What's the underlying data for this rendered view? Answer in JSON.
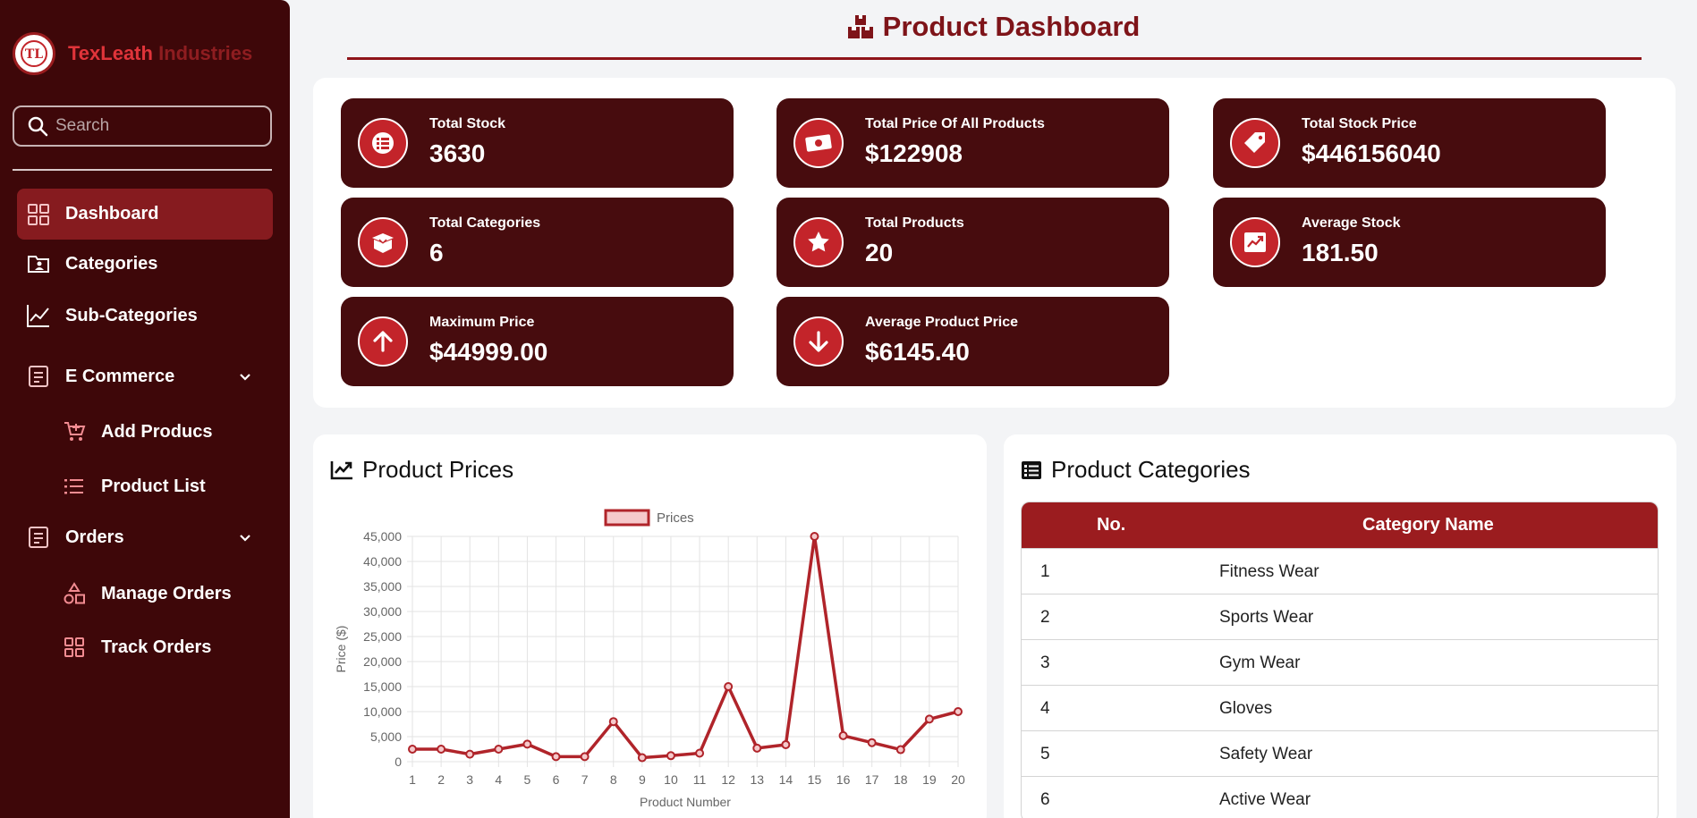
{
  "brand": {
    "name_part1": "TexLeath",
    "name_part2": "Industries",
    "logo_text": "TL"
  },
  "search": {
    "placeholder": "Search"
  },
  "sidebar": {
    "items": [
      {
        "label": "Dashboard",
        "icon": "grid-icon",
        "active": true
      },
      {
        "label": "Categories",
        "icon": "folder-user-icon"
      },
      {
        "label": "Sub-Categories",
        "icon": "line-chart-icon"
      },
      {
        "label": "E Commerce",
        "icon": "document-list-icon",
        "expandable": true
      },
      {
        "label": "Add Producs",
        "icon": "cart-add-icon",
        "sub": true
      },
      {
        "label": "Product List",
        "icon": "list-icon",
        "sub": true
      },
      {
        "label": "Orders",
        "icon": "document-list-icon",
        "expandable": true
      },
      {
        "label": "Manage Orders",
        "icon": "shapes-icon",
        "sub": true
      },
      {
        "label": "Track Orders",
        "icon": "grid-icon",
        "sub": true
      }
    ]
  },
  "header": {
    "title": "Product Dashboard",
    "icon": "boxes-icon"
  },
  "stats": [
    {
      "label": "Total Stock",
      "value": "3630",
      "icon": "list-icon"
    },
    {
      "label": "Total Price Of All Products",
      "value": "$122908",
      "icon": "money-icon"
    },
    {
      "label": "Total Stock Price",
      "value": "$446156040",
      "icon": "tag-icon"
    },
    {
      "label": "Total Categories",
      "value": "6",
      "icon": "open-box-icon"
    },
    {
      "label": "Total Products",
      "value": "20",
      "icon": "star-icon"
    },
    {
      "label": "Average Stock",
      "value": "181.50",
      "icon": "trend-up-icon"
    },
    {
      "label": "Maximum Price",
      "value": "$44999.00",
      "icon": "arrow-up-icon"
    },
    {
      "label": "Average Product Price",
      "value": "$6145.40",
      "icon": "arrow-down-icon"
    }
  ],
  "chart_panel": {
    "title": "Product Prices",
    "icon": "chart-line-icon"
  },
  "chart_data": {
    "type": "line",
    "title": "",
    "xlabel": "Product Number",
    "ylabel": "Price ($)",
    "x": [
      1,
      2,
      3,
      4,
      5,
      6,
      7,
      8,
      9,
      10,
      11,
      12,
      13,
      14,
      15,
      16,
      17,
      18,
      19,
      20
    ],
    "series": [
      {
        "name": "Prices",
        "values": [
          2500,
          2500,
          1500,
          2500,
          3500,
          1000,
          1000,
          8000,
          800,
          1200,
          1700,
          15000,
          2700,
          3400,
          44999,
          5200,
          3800,
          2400,
          8500,
          10000
        ]
      }
    ],
    "yticks": [
      "0",
      "5,000",
      "10,000",
      "15,000",
      "20,000",
      "25,000",
      "30,000",
      "35,000",
      "40,000",
      "45,000"
    ],
    "ylim": [
      0,
      45000
    ],
    "grid": true,
    "legend": "top-center",
    "line_color": "#b0242a"
  },
  "categories_panel": {
    "title": "Product Categories",
    "icon": "list-alt-icon",
    "columns": [
      "No.",
      "Category Name"
    ],
    "rows": [
      [
        "1",
        "Fitness Wear"
      ],
      [
        "2",
        "Sports Wear"
      ],
      [
        "3",
        "Gym Wear"
      ],
      [
        "4",
        "Gloves"
      ],
      [
        "5",
        "Safety Wear"
      ],
      [
        "6",
        "Active Wear"
      ]
    ]
  },
  "colors": {
    "sidebar": "#3e0709",
    "card": "#470c0e",
    "accent": "#c3242a",
    "title": "#7e1419",
    "table_header": "#9b1c1f"
  }
}
